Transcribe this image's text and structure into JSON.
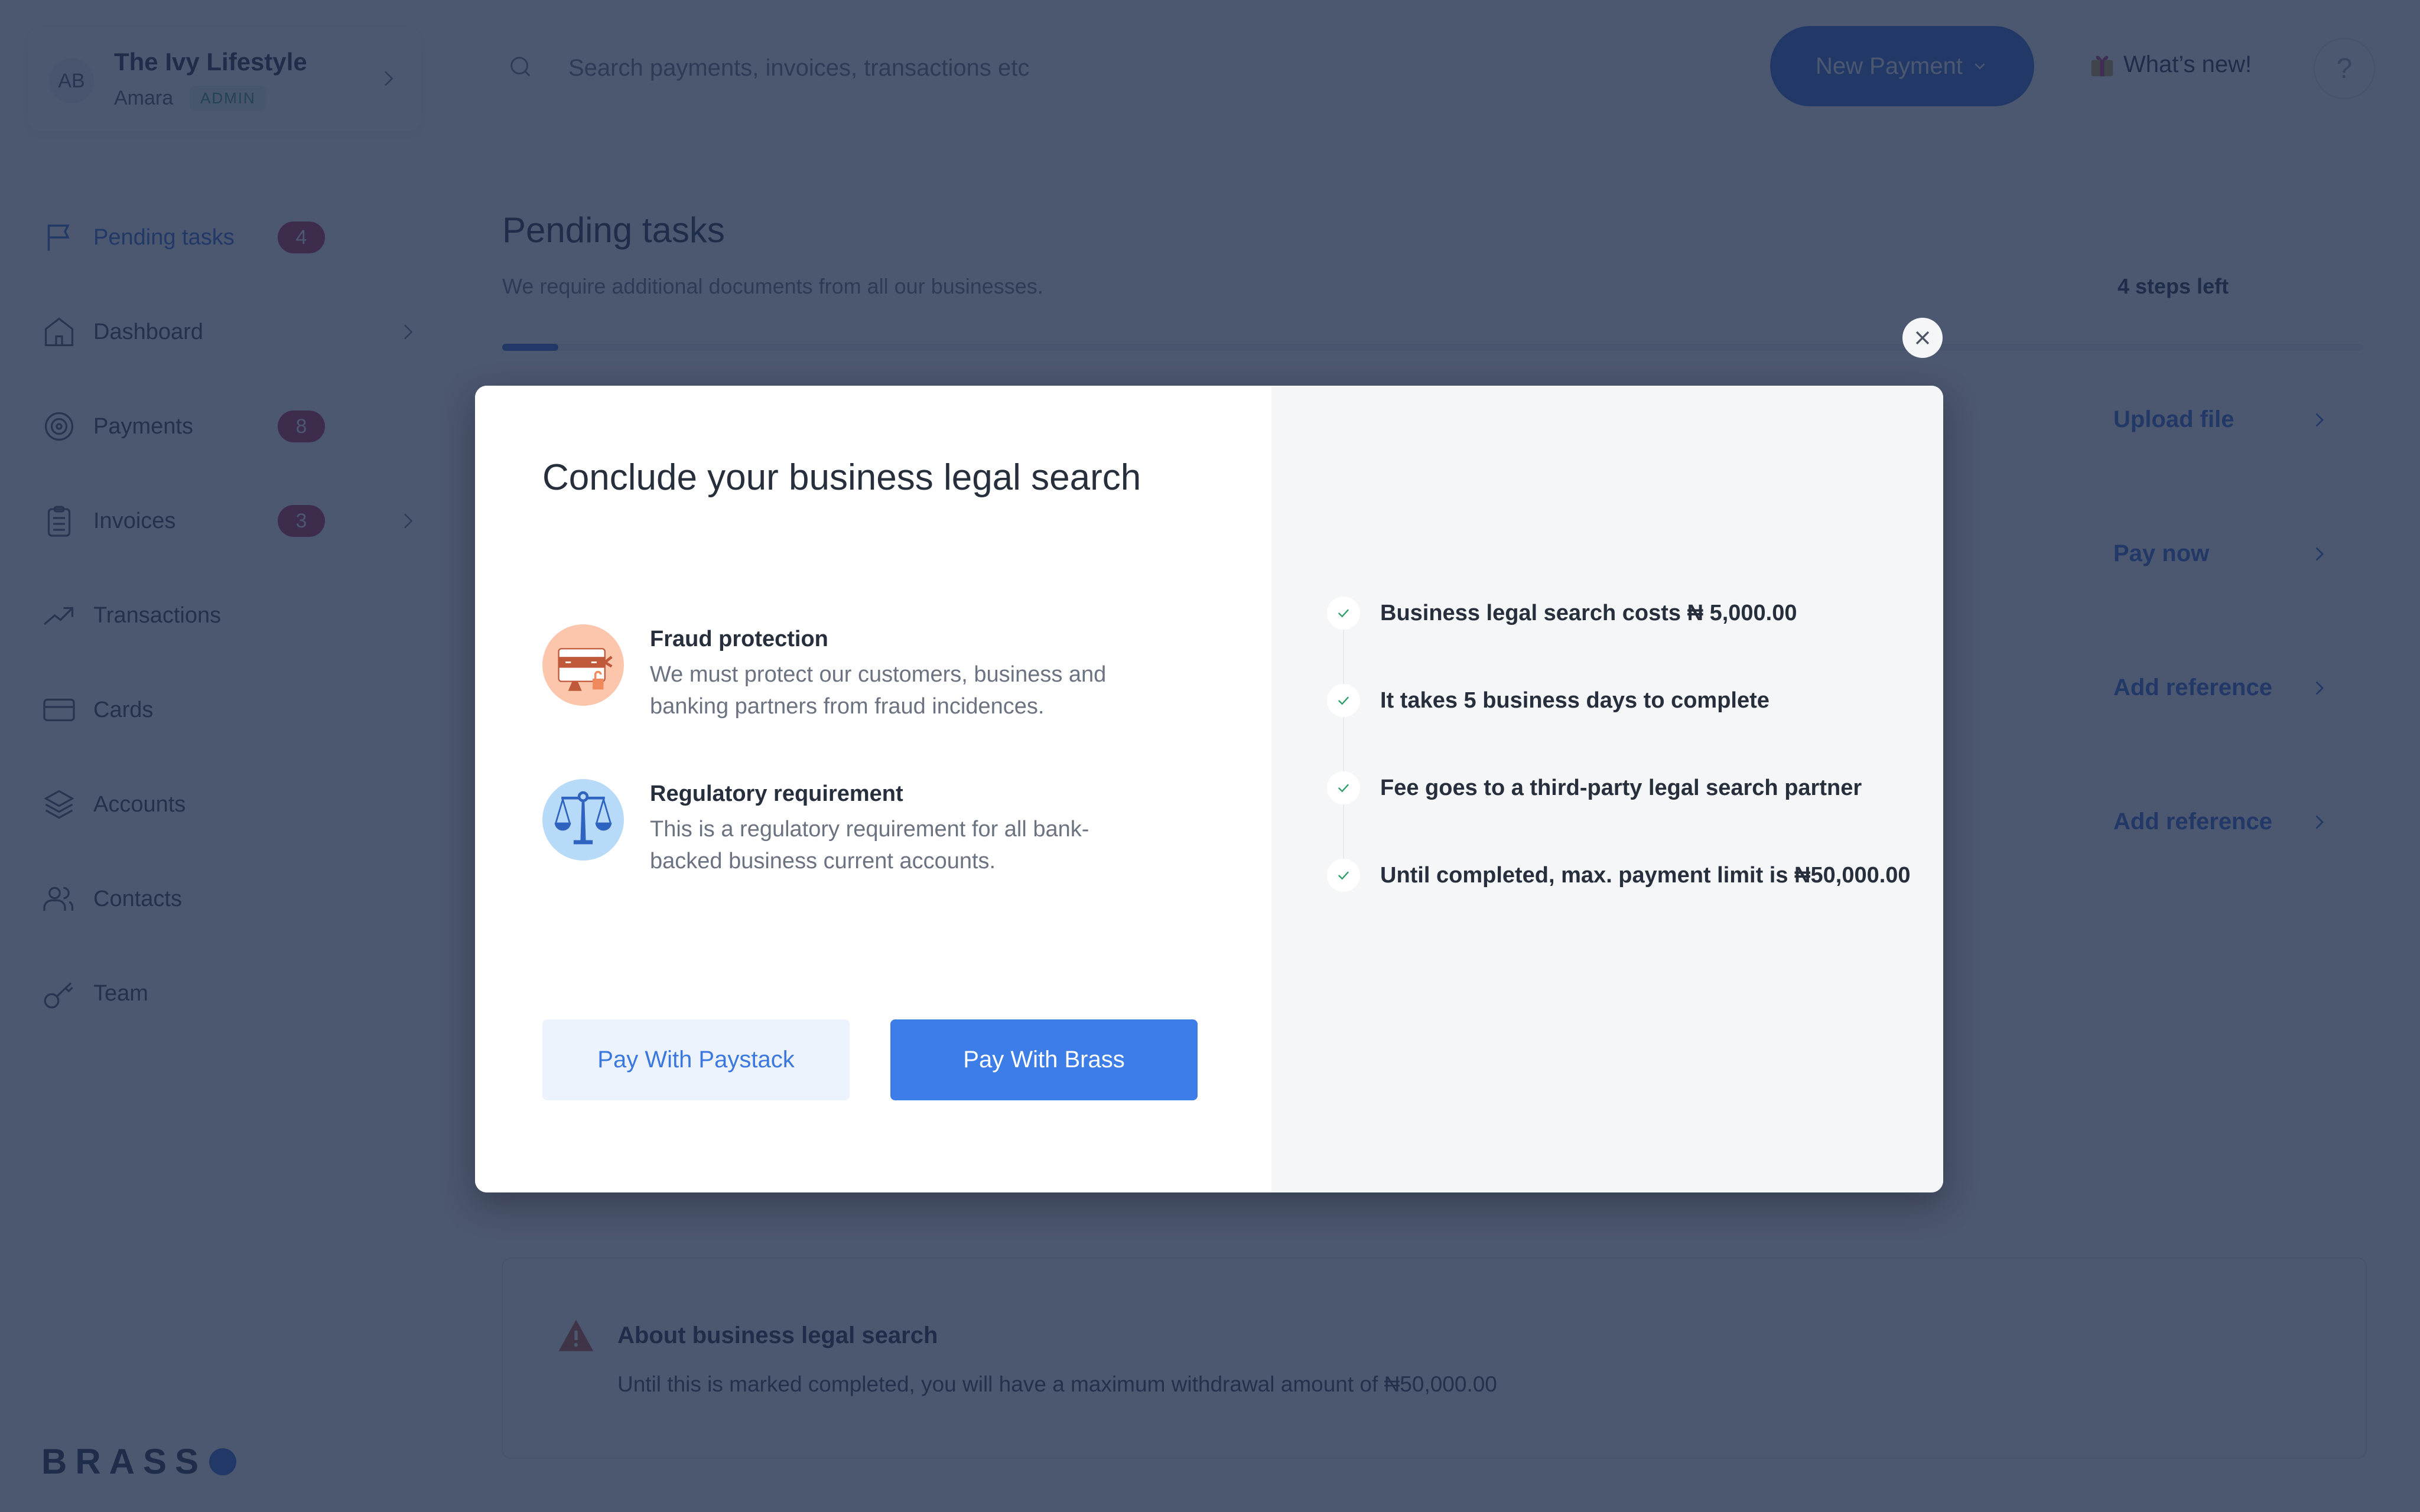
{
  "account": {
    "initials": "AB",
    "business_name": "The Ivy Lifestyle",
    "user_name": "Amara",
    "role_badge": "ADMIN"
  },
  "sidebar": {
    "items": [
      {
        "label": "Pending tasks",
        "icon": "flag-icon",
        "badge": "4",
        "active": true,
        "chevron": false
      },
      {
        "label": "Dashboard",
        "icon": "home-icon",
        "badge": null,
        "active": false,
        "chevron": true
      },
      {
        "label": "Payments",
        "icon": "target-icon",
        "badge": "8",
        "active": false,
        "chevron": false
      },
      {
        "label": "Invoices",
        "icon": "clipboard-icon",
        "badge": "3",
        "active": false,
        "chevron": true
      },
      {
        "label": "Transactions",
        "icon": "trending-up-icon",
        "badge": null,
        "active": false,
        "chevron": false
      },
      {
        "label": "Cards",
        "icon": "credit-card-icon",
        "badge": null,
        "active": false,
        "chevron": false
      },
      {
        "label": "Accounts",
        "icon": "layers-icon",
        "badge": null,
        "active": false,
        "chevron": false
      },
      {
        "label": "Contacts",
        "icon": "users-icon",
        "badge": null,
        "active": false,
        "chevron": false
      },
      {
        "label": "Team",
        "icon": "key-icon",
        "badge": null,
        "active": false,
        "chevron": false
      }
    ],
    "brand": "BRASS"
  },
  "topbar": {
    "search_placeholder": "Search payments, invoices, transactions etc",
    "search_value": "",
    "new_payment_label": "New Payment",
    "whats_new_label": "What’s new!",
    "help_label": "?"
  },
  "main": {
    "title": "Pending tasks",
    "subtitle": "We require additional documents from all our businesses.",
    "steps_left": "4 steps left",
    "progress_fraction": 0.03,
    "task_actions": [
      "Upload file",
      "Pay now",
      "Add reference",
      "Add reference"
    ],
    "info_box": {
      "title": "About business legal search",
      "text": "Until this is marked completed, you will have a maximum withdrawal amount of ₦50,000.00"
    }
  },
  "modal": {
    "title": "Conclude your business legal search",
    "reasons": [
      {
        "title": "Fraud protection",
        "text": "We must protect our customers, business and banking partners from fraud incidences.",
        "icon": "fraud-card-icon"
      },
      {
        "title": "Regulatory requirement",
        "text": "This is a regulatory requirement for all bank-backed business current accounts.",
        "icon": "scales-icon"
      }
    ],
    "checklist": [
      "Business legal search costs ₦ 5,000.00",
      "It takes 5 business days to complete",
      "Fee goes to a third-party legal search partner",
      "Until completed, max. payment limit is ₦50,000.00"
    ],
    "buttons": {
      "paystack": "Pay With Paystack",
      "brass": "Pay With Brass"
    }
  },
  "colors": {
    "accent": "#2f6bd8",
    "primary_button": "#3d7de8",
    "badge": "#b3284a",
    "check": "#2e9e6a",
    "overlay": "#1f2d4c"
  }
}
